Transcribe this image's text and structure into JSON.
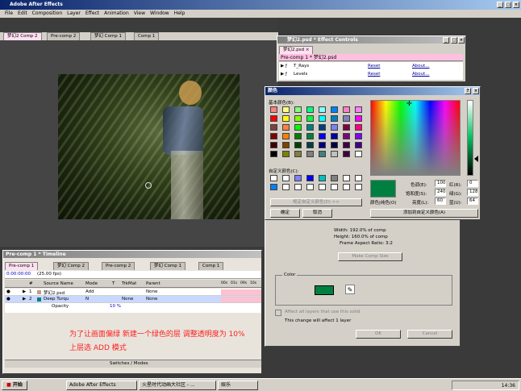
{
  "app": {
    "title": "Adobe After Effects"
  },
  "menu": [
    "File",
    "Edit",
    "Composition",
    "Layer",
    "Effect",
    "Animation",
    "View",
    "Window",
    "Help"
  ],
  "comp_tabs": [
    "梦幻2 Comp 2",
    "Pre-comp 2",
    "梦幻 Comp 1",
    "Comp 1"
  ],
  "effect_controls": {
    "title": "梦幻2.psd * Effect Controls",
    "tab": "梦幻2.psd",
    "header": "Pre-comp 1 * 梦幻2.psd",
    "rows": [
      {
        "name": "T_Rays",
        "reset": "Reset",
        "about": "About..."
      },
      {
        "name": "Levels",
        "reset": "Reset",
        "about": "About..."
      }
    ]
  },
  "color_dialog": {
    "title": "颜色",
    "basic_colors_label": "基本颜色(B):",
    "custom_colors_label": "自定义颜色(C):",
    "define_custom_button": "规定自定义颜色(D) >>",
    "ok_button": "确定",
    "cancel_button": "取消",
    "color_solid_label": "颜色|纯色(O)",
    "add_custom_button": "添加到自定义颜色(A)",
    "hue_label": "色调(E):",
    "hue_value": "100",
    "sat_label": "饱和度(S):",
    "sat_value": "240",
    "lum_label": "亮度(L):",
    "lum_value": "60",
    "red_label": "红(R):",
    "red_value": "0",
    "green_label": "绿(G):",
    "green_value": "128",
    "blue_label": "蓝(U):",
    "blue_value": "64",
    "basic_colors": [
      "#ff8080",
      "#ffff80",
      "#80ff80",
      "#00ff80",
      "#80ffff",
      "#0080ff",
      "#ff80c0",
      "#ff80ff",
      "#ff0000",
      "#ffff00",
      "#80ff00",
      "#00ff40",
      "#00ffff",
      "#0080c0",
      "#8080c0",
      "#ff00ff",
      "#804040",
      "#ff8040",
      "#00ff00",
      "#008080",
      "#004080",
      "#8080ff",
      "#800040",
      "#ff0080",
      "#800000",
      "#ff8000",
      "#008000",
      "#008040",
      "#0000ff",
      "#0000a0",
      "#800080",
      "#8000ff",
      "#400000",
      "#804000",
      "#004000",
      "#004040",
      "#000080",
      "#000040",
      "#400040",
      "#400080",
      "#000000",
      "#808000",
      "#808040",
      "#808080",
      "#408080",
      "#c0c0c0",
      "#400040",
      "#ffffff"
    ],
    "custom_colors": [
      "#ffffff",
      "#ffffff",
      "#8080ff",
      "#0000ff",
      "#00c0c0",
      "#808080",
      "#ffffff",
      "#ffffff",
      "#0080ff",
      "#ffffff",
      "#ffffff",
      "#ffffff",
      "#ffffff",
      "#ffffff",
      "#ffffff",
      "#ffffff"
    ],
    "current_color": "#008040"
  },
  "solid_settings": {
    "width_text": "Width: 192.0% of comp",
    "height_text": "Height: 160.0% of comp",
    "aspect_text": "Frame Aspect Ratio: 3:2",
    "make_comp_size_button": "Make Comp Size",
    "color_section_label": "Color",
    "swatch_color": "#008040",
    "affect_all_label": "Affect all layers that use this solid",
    "affect_note": "This change will affect 1 layer",
    "ok_button": "OK",
    "cancel_button": "Cancel"
  },
  "timeline": {
    "title": "Pre-comp 1 * Timeline",
    "tabs": [
      "Pre-comp 1",
      "梦幻 Comp 2",
      "Pre-comp 2",
      "梦幻 Comp 1",
      "Comp 1"
    ],
    "timecode": "0:00:00:00",
    "fps": "(25.00 fps)",
    "columns": [
      "#",
      "Source Name",
      "Mode",
      "T",
      "TrkMat",
      "Parent"
    ],
    "layers": [
      {
        "num": "1",
        "name": "梦幻2.psd",
        "mode": "Add",
        "trkmat": "",
        "parent": "None",
        "color": "#c0a080"
      },
      {
        "num": "2",
        "name": "Deep Turqu",
        "mode": "N",
        "trkmat": "None",
        "parent": "None",
        "color": "#008080"
      }
    ],
    "opacity_label": "Opacity",
    "opacity_value": "10 %",
    "ruler": [
      "00s",
      "01s",
      "09s",
      "10s"
    ],
    "footer": "Switches / Modes"
  },
  "annotation": {
    "line1": "为了让画面偏绿 新建一个绿色的层 调整透明度为 10%",
    "line2": "上层选 ADD 模式"
  },
  "taskbar": {
    "start": "开始",
    "items": [
      "Adobe After Effects",
      "火星时代动画大社区 - ...",
      "娱乐"
    ],
    "clock": "14:36"
  }
}
